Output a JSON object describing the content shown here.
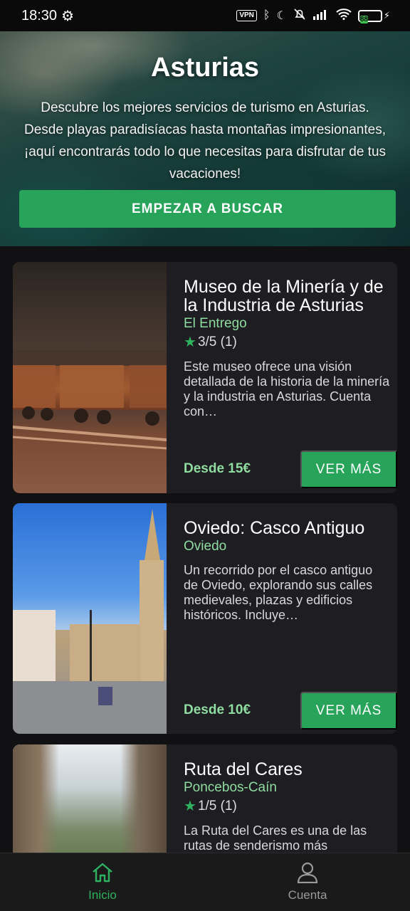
{
  "status_bar": {
    "time": "18:30",
    "vpn_label": "VPN",
    "battery": "88"
  },
  "hero": {
    "title": "Asturias",
    "description": "Descubre los mejores servicios de turismo en Asturias. Desde playas paradisíacas hasta montañas impresionantes, ¡aquí encontrarás todo lo que necesitas para disfrutar de tus vacaciones!",
    "button_label": "EMPEZAR A BUSCAR"
  },
  "cards": [
    {
      "title": "Museo de la Minería y de la Industria de Asturias",
      "location": "El Entrego",
      "rating": "3/5 (1)",
      "description": "Este museo ofrece una visión detallada de la historia de la minería y la industria en Asturias. Cuenta con…",
      "price": "Desde 15€",
      "button_label": "VER MÁS"
    },
    {
      "title": "Oviedo: Casco Antiguo",
      "location": "Oviedo",
      "description": "Un recorrido por el casco antiguo de Oviedo, explorando sus calles medievales, plazas y edificios históricos. Incluye…",
      "price": "Desde 10€",
      "button_label": "VER MÁS"
    },
    {
      "title": "Ruta del Cares",
      "location": "Poncebos-Caín",
      "rating": "1/5 (1)",
      "description": "La Ruta del Cares es una de las rutas de senderismo más"
    }
  ],
  "bottom_nav": {
    "home_label": "Inicio",
    "account_label": "Cuenta"
  },
  "colors": {
    "accent": "#27a35a",
    "location_text": "#8fdca0",
    "background": "#111114",
    "card": "#1e1e22"
  }
}
